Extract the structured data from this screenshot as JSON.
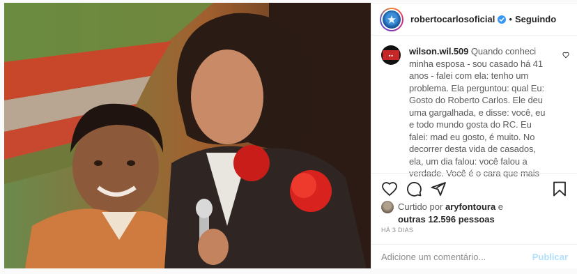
{
  "post": {
    "image_alt": "",
    "header": {
      "username": "robertocarlosoficial",
      "separator": "•",
      "follow_label": "Seguindo"
    },
    "comment": {
      "username": "wilson.wil.509",
      "text": "Quando conheci minha esposa - sou casado há 41 anos - falei com ela: tenho um problema. Ela perguntou: qual Eu: Gosto do Roberto Carlos. Ele deu uma gargalhada, e disse: você, eu e todo mundo gosta do RC. Eu falei: mad eu gosto, é muito. No decorrer desta vida de casados, ela, um dia falou: você falou a verdade. Você é o cara que mais"
    },
    "likes": {
      "prefix": "Curtido por",
      "liker": "aryfontoura",
      "middle": "e",
      "count": "outras 12.596 pessoas"
    },
    "time_ago": "HÁ 3 DIAS",
    "add_comment": {
      "placeholder": "Adicione um comentário...",
      "publish_label": "Publicar"
    },
    "colors": {
      "verified": "#3897f0",
      "publish_disabled": "#b2dffc",
      "secondary_text": "#8e8e8e"
    },
    "icons": [
      "verified-icon",
      "comment-heart-icon",
      "like-icon",
      "comment-icon",
      "share-icon",
      "save-icon"
    ]
  }
}
